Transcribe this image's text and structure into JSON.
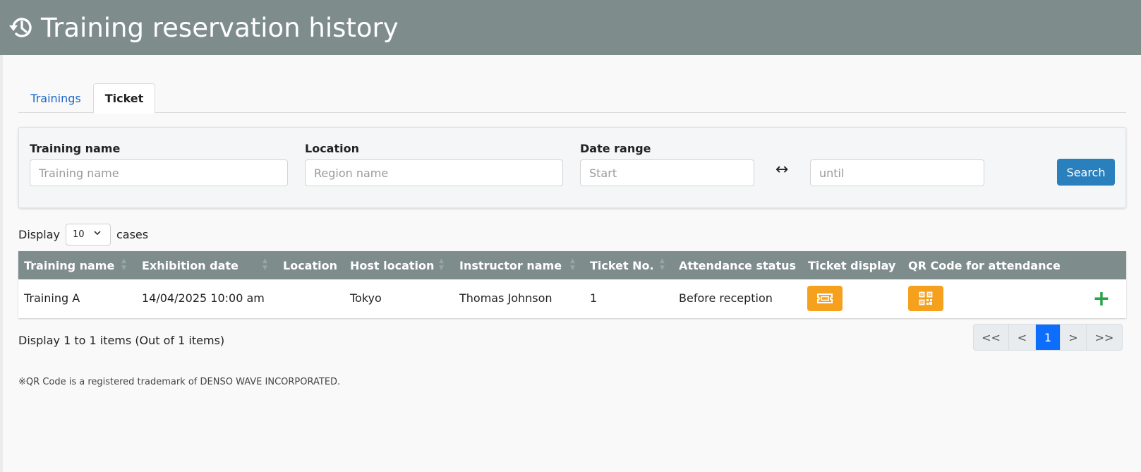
{
  "header": {
    "title": "Training reservation history",
    "icon": "history-icon"
  },
  "tabs": [
    {
      "label": "Trainings",
      "active": false
    },
    {
      "label": "Ticket",
      "active": true
    }
  ],
  "search": {
    "training_name": {
      "label": "Training name",
      "placeholder": "Training name",
      "value": ""
    },
    "location": {
      "label": "Location",
      "placeholder": "Region name",
      "value": ""
    },
    "date_range": {
      "label": "Date range",
      "start_placeholder": "Start",
      "until_placeholder": "until",
      "separator": "↔"
    },
    "button_label": "Search"
  },
  "display": {
    "prefix": "Display",
    "page_size": "10",
    "suffix": "cases"
  },
  "table": {
    "columns": [
      "Training name",
      "Exhibition date",
      "Location",
      "Host location",
      "Instructor name",
      "Ticket No.",
      "Attendance status",
      "Ticket display",
      "QR Code for attendance"
    ],
    "rows": [
      {
        "training_name": "Training A",
        "exhibition_date": "14/04/2025 10:00 am",
        "location": "",
        "host_location": "Tokyo",
        "instructor_name": "Thomas Johnson",
        "ticket_no": "1",
        "attendance_status": "Before reception",
        "ticket_display_icon": "ticket-icon",
        "qr_icon": "qr-code-icon"
      }
    ]
  },
  "summary": "Display 1 to 1 items (Out of 1 items)",
  "pagination": {
    "first": "<<",
    "prev": "<",
    "current": "1",
    "next": ">",
    "last": ">>"
  },
  "footnote": "※QR Code is a registered trademark of DENSO WAVE INCORPORATED.",
  "colors": {
    "header_bg": "#7f8c8c",
    "accent_blue": "#2a7fbd",
    "action_orange": "#f5a11e",
    "expand_green": "#2aa44a",
    "active_page": "#0d6efd"
  }
}
